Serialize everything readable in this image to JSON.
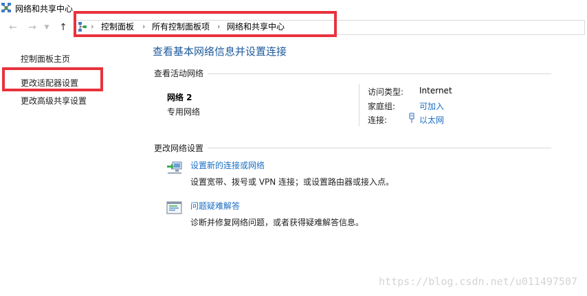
{
  "window": {
    "title": "网络和共享中心"
  },
  "nav": {
    "back_icon": "arrow-left-icon",
    "forward_icon": "arrow-right-icon",
    "dropdown_icon": "chevron-down-icon",
    "up_icon": "arrow-up-icon",
    "breadcrumb": [
      "控制面板",
      "所有控制面板项",
      "网络和共享中心"
    ]
  },
  "sidebar": {
    "items": [
      {
        "label": "控制面板主页"
      },
      {
        "label": "更改适配器设置"
      },
      {
        "label": "更改高级共享设置"
      }
    ]
  },
  "main": {
    "title": "查看基本网络信息并设置连接",
    "active_section": "查看活动网络",
    "network": {
      "name": "网络  2",
      "type": "专用网络",
      "access_label": "访问类型:",
      "access_value": "Internet",
      "homegroup_label": "家庭组:",
      "homegroup_value": "可加入",
      "connection_label": "连接:",
      "connection_value": "以太网"
    },
    "change_section": "更改网络设置",
    "tasks": [
      {
        "link": "设置新的连接或网络",
        "desc": "设置宽带、拨号或 VPN 连接；或设置路由器或接入点。"
      },
      {
        "link": "问题疑难解答",
        "desc": "诊断并修复网络问题，或者获得疑难解答信息。"
      }
    ]
  },
  "watermark": "https://blog.csdn.net/u011497507",
  "colors": {
    "highlight_box": "#e8323c",
    "link": "#1a6ec4",
    "heading": "#1c5a9c"
  }
}
